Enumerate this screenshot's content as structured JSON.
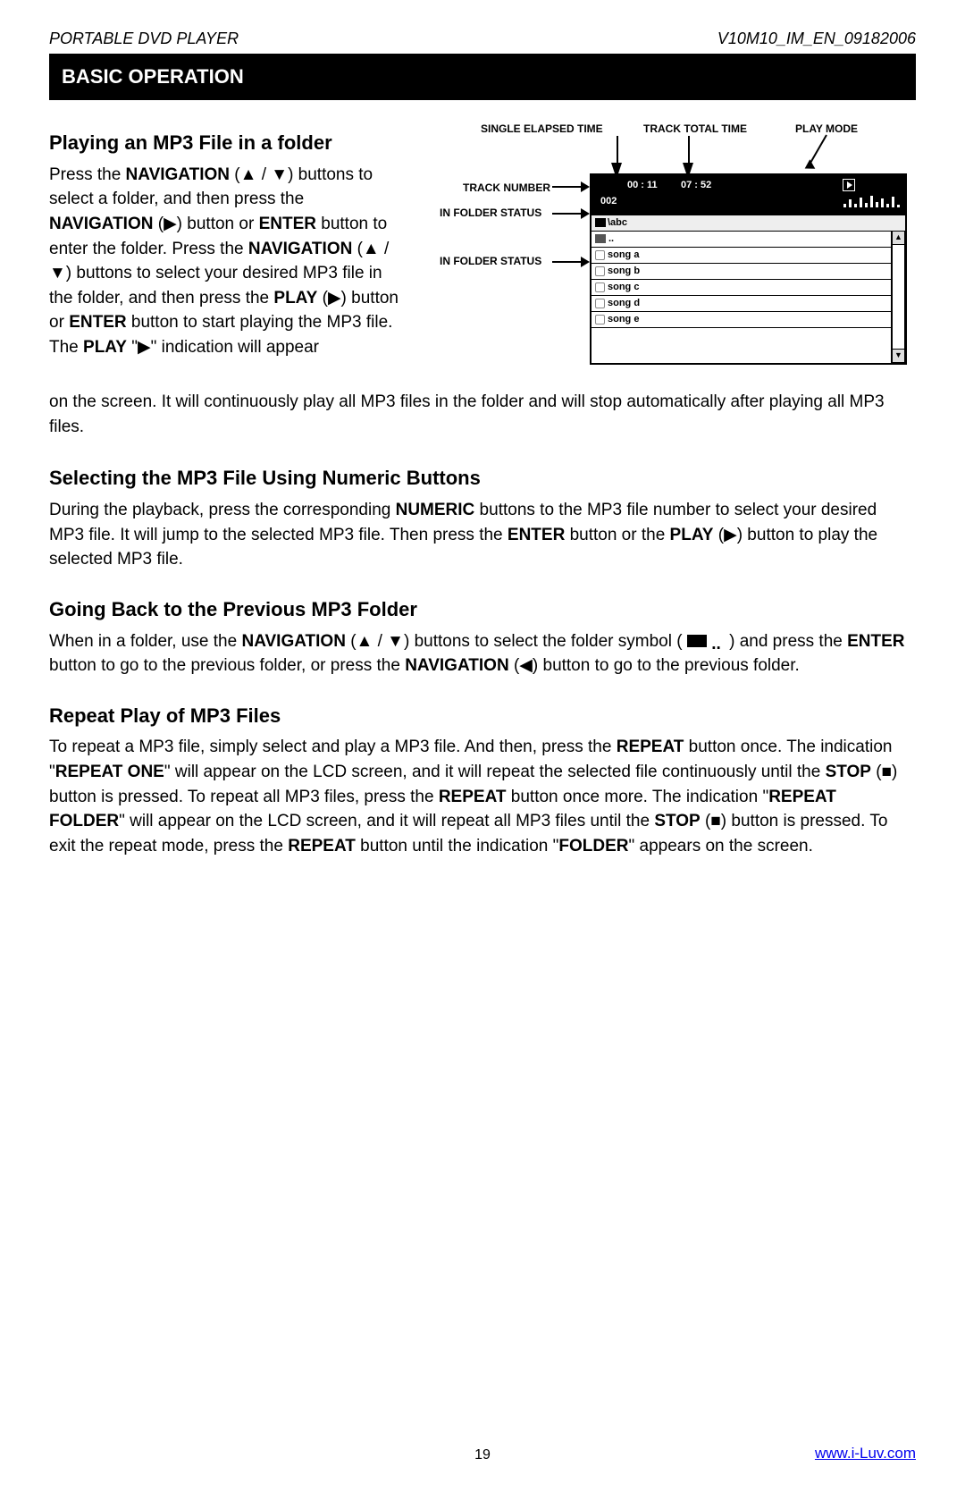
{
  "header": {
    "left": "PORTABLE DVD PLAYER",
    "right": "V10M10_IM_EN_09182006"
  },
  "bar_title": "BASIC OPERATION",
  "section1": {
    "heading": "Playing an MP3 File in a folder",
    "p1a": "Press the ",
    "nav_bold": "NAVIGATION",
    "p1b": " (▲ / ▼) buttons to select a folder, and then press the ",
    "p1c": " (▶) button or ",
    "enter_bold": "ENTER",
    "p1d": " button to enter the folder. Press the ",
    "p1e": " (▲ / ▼) buttons to select your desired MP3 file in the folder, and then press the ",
    "play_bold": "PLAY",
    "p1f": " (▶) button or ",
    "p1g": " button to start playing the MP3 file. The ",
    "p1h": " \"▶\" indication will appear",
    "continuation": "on the screen. It will continuously play all MP3 files in the folder and will stop automatically after playing all MP3 files."
  },
  "diagram": {
    "labels": {
      "elapsed": "SINGLE ELAPSED TIME",
      "total": "TRACK TOTAL TIME",
      "mode": "PLAY MODE",
      "tracknum": "TRACK NUMBER",
      "status1": "IN FOLDER STATUS",
      "status2": "IN FOLDER STATUS"
    },
    "screen": {
      "time1": "00 : 11",
      "time2": "07 : 52",
      "num": "002",
      "path": "\\abc",
      "up": "..",
      "songs": [
        "song a",
        "song b",
        "song c",
        "song d",
        "song e"
      ]
    }
  },
  "section2": {
    "heading": "Selecting the MP3 File Using Numeric Buttons",
    "t1": "During the playback, press the corresponding ",
    "numeric": "NUMERIC",
    "t2": " buttons to the MP3 file number to select your desired MP3 file. It will jump to the selected MP3 file. Then press the ",
    "enter": "ENTER",
    "t3": " button or the ",
    "play": "PLAY",
    "t4": " (▶) button to play the selected MP3 file."
  },
  "section3": {
    "heading": "Going Back to the Previous MP3 Folder",
    "t1": "When in a folder, use the ",
    "nav": "NAVIGATION",
    "t2": " (▲ / ▼) buttons to select the folder symbol ( ",
    "t3": " ) and press the ",
    "enter": "ENTER",
    "t4": " button to go to the previous folder, or press the ",
    "t5": " (◀) button to go to the previous folder."
  },
  "section4": {
    "heading": "Repeat Play of MP3 Files",
    "t1": "To repeat a MP3 file, simply select and play a MP3 file. And then, press the ",
    "repeat": "REPEAT",
    "t2": " button once. The indication \"",
    "repone": "REPEAT ONE",
    "t3": "\" will appear on the LCD screen, and it will repeat the selected file continuously until the ",
    "stop": "STOP",
    "t4": " (■) button is pressed. To repeat all MP3 files, press the ",
    "t5": " button once more. The indication \"",
    "repfolder": "REPEAT FOLDER",
    "t6": "\" will appear on the LCD screen, and it will repeat all MP3 files until the ",
    "t7": " (■) button is pressed. To exit the repeat mode, press the ",
    "t8": " button until the indication \"",
    "folder": "FOLDER",
    "t9": "\" appears on the screen."
  },
  "footer": {
    "page": "19",
    "link": "www.i-Luv.com"
  }
}
